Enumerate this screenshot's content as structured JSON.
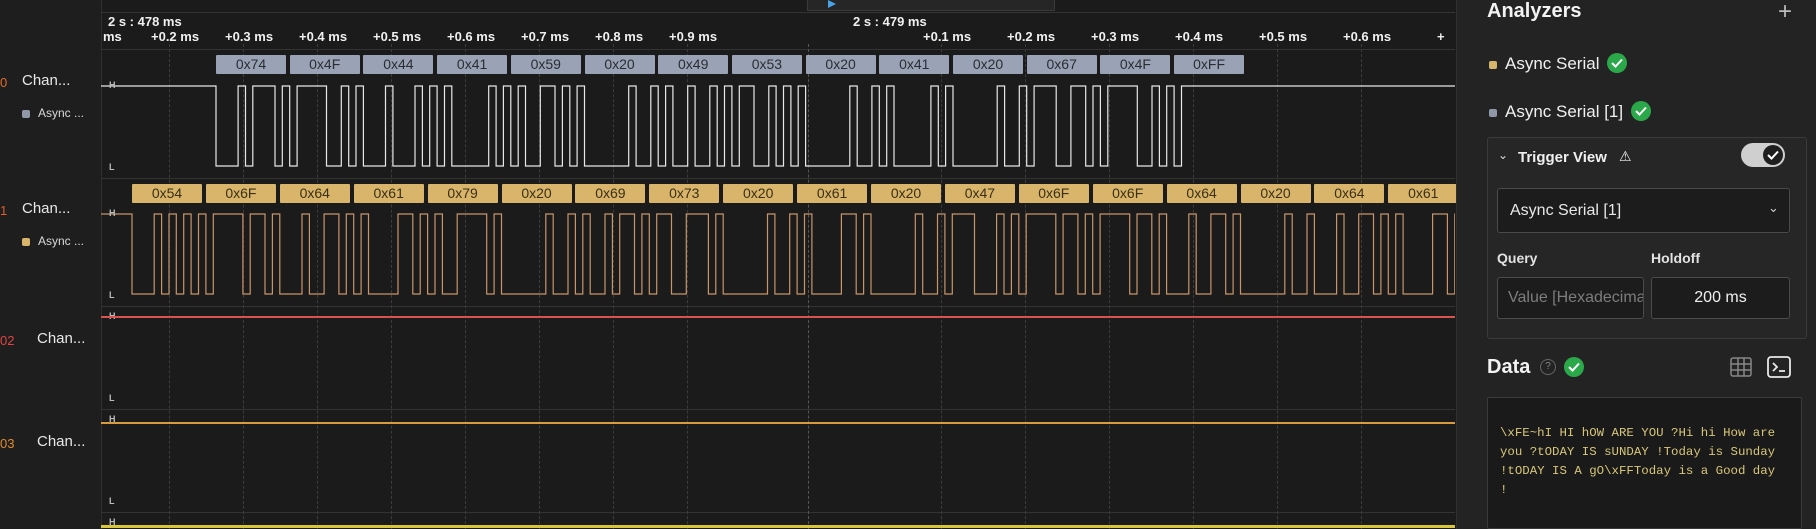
{
  "channels": [
    {
      "num": "0",
      "num_color": "#e06c2a",
      "name": "Chan...",
      "analyzer": "Async ...",
      "analyzer_color": "#8f97a8"
    },
    {
      "num": "1",
      "num_color": "#e05a2a",
      "name": "Chan...",
      "analyzer": "Async ...",
      "analyzer_color": "#d7b56b"
    },
    {
      "num": "02",
      "num_color": "#e04545",
      "name": "Chan..."
    },
    {
      "num": "03",
      "num_color": "#e08a2a",
      "name": "Chan..."
    }
  ],
  "timeline": {
    "abs_time_1": "2 s : 478 ms",
    "abs_time_2": "2 s : 479 ms",
    "ticks_left": [
      "ms",
      "+0.2 ms",
      "+0.3 ms",
      "+0.4 ms",
      "+0.5 ms",
      "+0.6 ms",
      "+0.7 ms",
      "+0.8 ms",
      "+0.9 ms"
    ],
    "ticks_right": [
      "+0.1 ms",
      "+0.2 ms",
      "+0.3 ms",
      "+0.4 ms",
      "+0.5 ms",
      "+0.6 ms",
      "+"
    ],
    "high_label": "H",
    "low_label": "L"
  },
  "decode_ch0": [
    "0x74",
    "0x4F",
    "0x44",
    "0x41",
    "0x59",
    "0x20",
    "0x49",
    "0x53",
    "0x20",
    "0x41",
    "0x20",
    "0x67",
    "0x4F",
    "0xFF"
  ],
  "decode_ch1": [
    "0x54",
    "0x6F",
    "0x64",
    "0x61",
    "0x79",
    "0x20",
    "0x69",
    "0x73",
    "0x20",
    "0x61",
    "0x20",
    "0x47",
    "0x6F",
    "0x6F",
    "0x64",
    "0x20",
    "0x64",
    "0x61"
  ],
  "colors": {
    "ch0_wave": "#e8e8e8",
    "ch1_wave": "#c8956a",
    "ch2_line": "#d9534f",
    "ch3_line": "#d99a3c",
    "accent_green": "#2ba84a"
  },
  "analyzers_panel": {
    "title": "Analyzers",
    "add_icon": "plus-icon",
    "items": [
      {
        "label": "Async Serial",
        "color": "#d7b56b",
        "status_icon": "check-circle-icon"
      },
      {
        "label": "Async Serial [1]",
        "color": "#8f97a8",
        "status_icon": "check-circle-icon"
      }
    ]
  },
  "trigger_view": {
    "title": "Trigger View",
    "warning_icon": "warning-icon",
    "toggle_on": true,
    "selected_analyzer": "Async Serial [1]",
    "query_label": "Query",
    "query_placeholder": "Value [Hexadecimal]",
    "holdoff_label": "Holdoff",
    "holdoff_value": "200 ms"
  },
  "data_panel": {
    "title": "Data",
    "help_icon": "help-icon",
    "table_icon": "table-icon",
    "terminal_icon": "terminal-icon",
    "terminal_text": "\\xFE~hI HI hOW ARE YOU ?Hi hi How are you ?tODAY IS sUNDAY !Today is Sunday !tODAY IS A gO\\xFFToday is a Good day !"
  }
}
